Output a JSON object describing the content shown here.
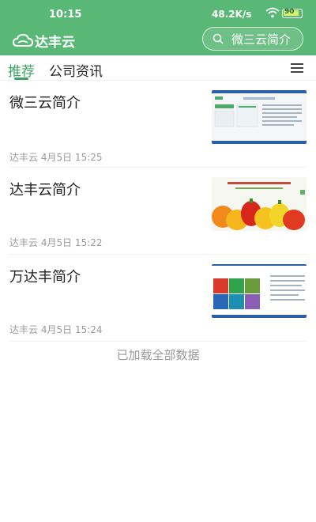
{
  "status_bar": {
    "time": "10:15",
    "network_speed": "48.2K/s",
    "battery": "90"
  },
  "app_bar": {
    "logo_text": "达丰云",
    "search_placeholder": "微三云简介"
  },
  "tabs": [
    {
      "label": "推荐",
      "active": true
    },
    {
      "label": "公司资讯",
      "active": false
    }
  ],
  "articles": [
    {
      "title": "微三云简介",
      "source": "达丰云",
      "date": "4月5日 15:25"
    },
    {
      "title": "达丰云简介",
      "source": "达丰云",
      "date": "4月5日 15:22"
    },
    {
      "title": "万达丰简介",
      "source": "达丰云",
      "date": "4月5日 15:24"
    }
  ],
  "footer_text": "已加载全部数据",
  "colors": {
    "brand_green": "#5ab877",
    "tab_active": "#3aa363"
  }
}
